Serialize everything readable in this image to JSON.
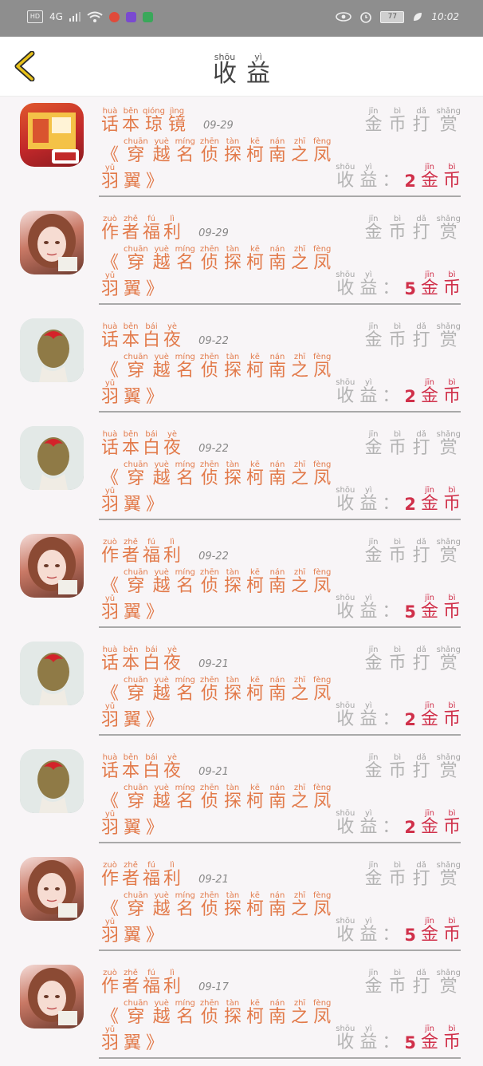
{
  "status_bar": {
    "left": [
      "HD",
      "4G"
    ],
    "time": "10:02",
    "battery": "77"
  },
  "header": {
    "title": [
      {
        "char": "收",
        "pinyin": "shōu"
      },
      {
        "char": "益",
        "pinyin": "yì"
      }
    ]
  },
  "reward_label": [
    {
      "char": "金",
      "pinyin": "jīn"
    },
    {
      "char": "币",
      "pinyin": "bì"
    },
    {
      "char": "打",
      "pinyin": "dǎ"
    },
    {
      "char": "赏",
      "pinyin": "shǎng"
    }
  ],
  "income_label": [
    {
      "char": "收",
      "pinyin": "shōu"
    },
    {
      "char": "益",
      "pinyin": "yì"
    }
  ],
  "income_colon": "：",
  "coin_unit": [
    {
      "char": "金",
      "pinyin": "jīn"
    },
    {
      "char": "币",
      "pinyin": "bì"
    }
  ],
  "book_title": {
    "open": "《",
    "close": "》",
    "chars": [
      {
        "char": "穿",
        "pinyin": "chuān"
      },
      {
        "char": "越",
        "pinyin": "yuè"
      },
      {
        "char": "名",
        "pinyin": "míng"
      },
      {
        "char": "侦",
        "pinyin": "zhēn"
      },
      {
        "char": "探",
        "pinyin": "tàn"
      },
      {
        "char": "柯",
        "pinyin": "kē"
      },
      {
        "char": "南",
        "pinyin": "nán"
      },
      {
        "char": "之",
        "pinyin": "zhī"
      },
      {
        "char": "凤",
        "pinyin": "fèng"
      },
      {
        "char": "羽",
        "pinyin": "yǔ"
      },
      {
        "char": "翼",
        "pinyin": ""
      }
    ]
  },
  "items": [
    {
      "avatar": "shop",
      "name": [
        {
          "char": "话",
          "pinyin": "huà"
        },
        {
          "char": "本",
          "pinyin": "běn"
        },
        {
          "char": "琼",
          "pinyin": "qióng"
        },
        {
          "char": "镜",
          "pinyin": "jìng"
        }
      ],
      "date": "09-29",
      "amount": "2"
    },
    {
      "avatar": "girl",
      "name": [
        {
          "char": "作",
          "pinyin": "zuò"
        },
        {
          "char": "者",
          "pinyin": "zhě"
        },
        {
          "char": "福",
          "pinyin": "fú"
        },
        {
          "char": "利",
          "pinyin": "lì"
        }
      ],
      "date": "09-29",
      "amount": "5"
    },
    {
      "avatar": "bun",
      "name": [
        {
          "char": "话",
          "pinyin": "huà"
        },
        {
          "char": "本",
          "pinyin": "běn"
        },
        {
          "char": "白",
          "pinyin": "bái"
        },
        {
          "char": "夜",
          "pinyin": "yè"
        }
      ],
      "date": "09-22",
      "amount": "2"
    },
    {
      "avatar": "bun",
      "name": [
        {
          "char": "话",
          "pinyin": "huà"
        },
        {
          "char": "本",
          "pinyin": "běn"
        },
        {
          "char": "白",
          "pinyin": "bái"
        },
        {
          "char": "夜",
          "pinyin": "yè"
        }
      ],
      "date": "09-22",
      "amount": "2"
    },
    {
      "avatar": "girl",
      "name": [
        {
          "char": "作",
          "pinyin": "zuò"
        },
        {
          "char": "者",
          "pinyin": "zhě"
        },
        {
          "char": "福",
          "pinyin": "fú"
        },
        {
          "char": "利",
          "pinyin": "lì"
        }
      ],
      "date": "09-22",
      "amount": "5"
    },
    {
      "avatar": "bun",
      "name": [
        {
          "char": "话",
          "pinyin": "huà"
        },
        {
          "char": "本",
          "pinyin": "běn"
        },
        {
          "char": "白",
          "pinyin": "bái"
        },
        {
          "char": "夜",
          "pinyin": "yè"
        }
      ],
      "date": "09-21",
      "amount": "2"
    },
    {
      "avatar": "bun",
      "name": [
        {
          "char": "话",
          "pinyin": "huà"
        },
        {
          "char": "本",
          "pinyin": "běn"
        },
        {
          "char": "白",
          "pinyin": "bái"
        },
        {
          "char": "夜",
          "pinyin": "yè"
        }
      ],
      "date": "09-21",
      "amount": "2"
    },
    {
      "avatar": "girl",
      "name": [
        {
          "char": "作",
          "pinyin": "zuò"
        },
        {
          "char": "者",
          "pinyin": "zhě"
        },
        {
          "char": "福",
          "pinyin": "fú"
        },
        {
          "char": "利",
          "pinyin": "lì"
        }
      ],
      "date": "09-21",
      "amount": "5"
    },
    {
      "avatar": "girl",
      "name": [
        {
          "char": "作",
          "pinyin": "zuò"
        },
        {
          "char": "者",
          "pinyin": "zhě"
        },
        {
          "char": "福",
          "pinyin": "fú"
        },
        {
          "char": "利",
          "pinyin": "lì"
        }
      ],
      "date": "09-17",
      "amount": "5"
    }
  ],
  "colors": {
    "accent_orange": "#e27a4a",
    "coin_red": "#d0304a",
    "muted_gray": "#b3b3b3",
    "back_arrow": "#e8c21a"
  }
}
